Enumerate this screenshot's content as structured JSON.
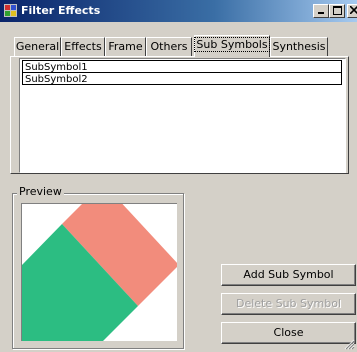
{
  "window": {
    "title": "Filter Effects",
    "minimize_label": "_",
    "maximize_label": "□",
    "close_label": "×"
  },
  "tabs": [
    {
      "label": "General"
    },
    {
      "label": "Effects"
    },
    {
      "label": "Frame"
    },
    {
      "label": "Others"
    },
    {
      "label": "Sub Symbols",
      "active": true
    },
    {
      "label": "Synthesis"
    }
  ],
  "sub_symbols": {
    "items": [
      "SubSymbol1",
      "SubSymbol2"
    ]
  },
  "preview": {
    "label": "Preview",
    "colors": {
      "top_right": "#f28c7c",
      "bottom_left": "#2cbd82"
    }
  },
  "buttons": {
    "add_sub_symbol": "Add Sub Symbol",
    "delete_sub_symbol": "Delete Sub Symbol",
    "close": "Close"
  }
}
